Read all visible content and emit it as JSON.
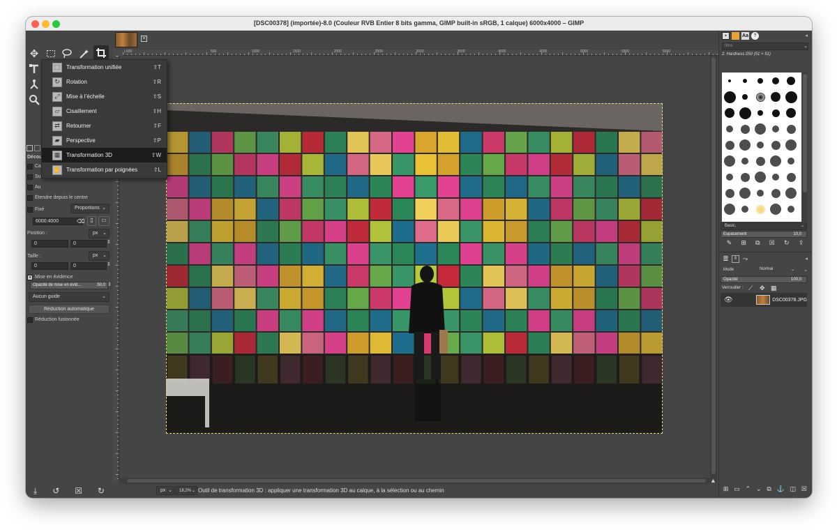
{
  "window": {
    "title": "[DSC00378] (importée)-8.0 (Couleur RVB Entier 8 bits gamma, GIMP built-in sRGB, 1 calque) 6000x4000 – GIMP"
  },
  "colors": {
    "traffic_close": "#fe5f57",
    "traffic_min": "#febc2e",
    "traffic_max": "#28c840",
    "selection": "#e8e070",
    "canvas_bg": "#454545"
  },
  "menu": {
    "items": [
      {
        "label": "Transformation unifiée",
        "shortcut": "⇧T"
      },
      {
        "label": "Rotation",
        "shortcut": "⇧R"
      },
      {
        "label": "Mise à l’échelle",
        "shortcut": "⇧S"
      },
      {
        "label": "Cisaillement",
        "shortcut": "⇧H"
      },
      {
        "label": "Retourner",
        "shortcut": "⇧F"
      },
      {
        "label": "Perspective",
        "shortcut": "⇧P"
      },
      {
        "label": "Transformation 3D",
        "shortcut": "⇧W"
      },
      {
        "label": "Transformation par poignées",
        "shortcut": "⇧L"
      }
    ]
  },
  "tool_options": {
    "tab_label": "Découp",
    "checkbox_labels": [
      "Ca",
      "Su",
      "Au"
    ],
    "expand_from_center": "Étendre depuis le centre",
    "fixed_label": "Fixé",
    "fixed_mode": "Proportions",
    "ratio_value": "6000:4000",
    "position_label": "Position :",
    "position_unit": "px",
    "position_x": "0",
    "position_y": "0",
    "size_label": "Taille :",
    "size_unit": "px",
    "size_w": "0",
    "size_h": "0",
    "highlight_label": "Mise en évidence",
    "highlight_opacity_label": "Opacité de mise en évid...",
    "highlight_opacity_value": "50,0",
    "guide_select": "Aucun guide",
    "auto_shrink_button": "Réduction automatique",
    "merged_shrink_label": "Réduction fusionnée"
  },
  "ruler": {
    "top_labels": [
      "500",
      "1000",
      "1500",
      "2000",
      "2500",
      "3000",
      "3500",
      "4000",
      "4500",
      "5000",
      "5500",
      "6000"
    ],
    "top_first_label": "|-500"
  },
  "statusbar": {
    "unit": "px",
    "zoom": "18,2%",
    "message": "Outil de transformation 3D : appliquer une transformation 3D au calque, à la sélection ou au chemin"
  },
  "brushes": {
    "filter_placeholder": "filtre",
    "current_brush": "2. Hardness 050 (51 × 51)",
    "preset": "Basic,",
    "spacing_label": "Espacement",
    "spacing_value": "10,0"
  },
  "layers": {
    "mode_label": "Mode",
    "mode_value": "Normal",
    "opacity_label": "Opacité",
    "opacity_value": "100,0",
    "lock_label": "Verrouiller :",
    "layer_name": "DSC00378.JPG"
  }
}
